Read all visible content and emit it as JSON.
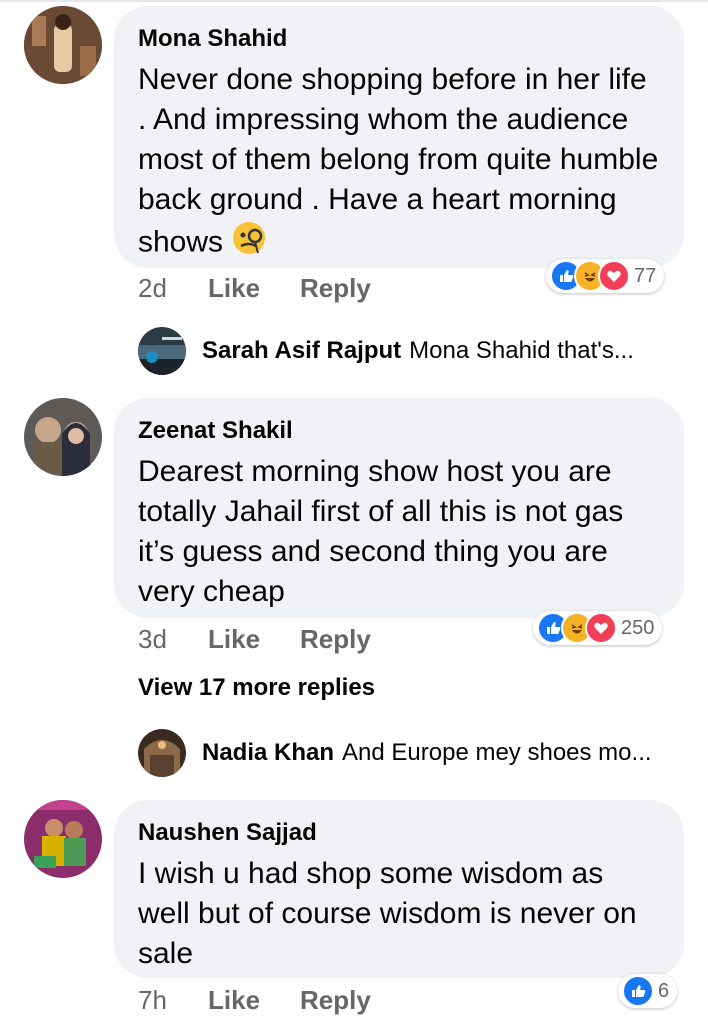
{
  "comments": [
    {
      "author": "Mona Shahid",
      "text": "Never done shopping before in her life . And impressing whom the audience most of them belong from quite humble back ground . Have a heart morning shows",
      "time": "2d",
      "like_label": "Like",
      "reply_label": "Reply",
      "reaction_count": "77",
      "reactions": [
        "like",
        "haha",
        "love"
      ]
    },
    {
      "author": "Zeenat Shakil",
      "text": "Dearest morning show host you are totally Jahail first of all this is not gas it’s guess and second thing you are very cheap",
      "time": "3d",
      "like_label": "Like",
      "reply_label": "Reply",
      "reaction_count": "250",
      "reactions": [
        "like",
        "haha",
        "love"
      ],
      "view_more": "View 17 more replies"
    },
    {
      "author": "Naushen Sajjad",
      "text": "I wish u had shop some wisdom as well but of course wisdom is never on sale",
      "time": "7h",
      "like_label": "Like",
      "reply_label": "Reply",
      "reaction_count": "6",
      "reactions": [
        "like"
      ]
    }
  ],
  "replies": [
    {
      "author": "Sarah Asif Rajput",
      "text": "Mona Shahid that's..."
    },
    {
      "author": "Nadia Khan",
      "text": "And Europe mey shoes mo..."
    }
  ],
  "colors": {
    "bubble": "#f0f2f5",
    "meta": "#65676b",
    "like": "#1877f2",
    "haha": "#f7b125",
    "love": "#f33e58"
  },
  "icons": {
    "monocle": "face-with-monocle-icon",
    "like": "thumbs-up-icon",
    "haha": "laughing-face-icon",
    "love": "heart-icon"
  }
}
